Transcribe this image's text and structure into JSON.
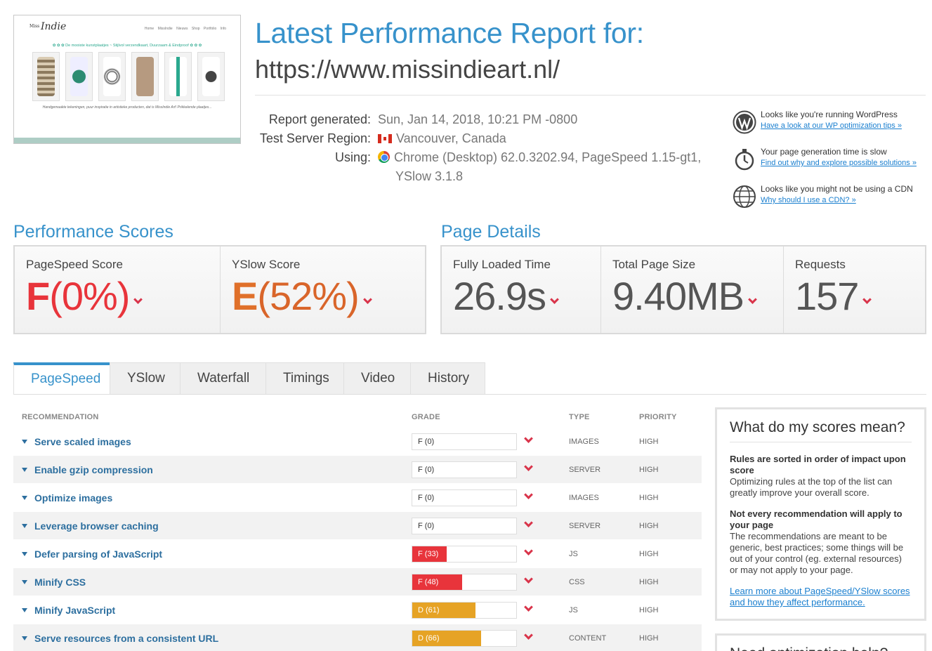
{
  "header": {
    "title": "Latest Performance Report for:",
    "url": "https://www.missindieart.nl/"
  },
  "thumbnail": {
    "logo": "Indie",
    "logo_small": "Miss",
    "nav": "Home MissIndie Nieuws Shop Portfolio Info",
    "strip": "✿ ✿ ✿  De mooiste kunstplaatjes ~ Stijlvol verzendkaart, Duurzaam & Eindproof  ✿ ✿ ✿",
    "paragraph": "Handgemaakte tekeningen, puur inspiratie in artistieke producten, dat is MissIndie Art! Prikkelende plaatjes..."
  },
  "meta": {
    "rows": [
      {
        "label": "Report generated:",
        "value": "Sun, Jan 14, 2018, 10:21 PM -0800"
      },
      {
        "label": "Test Server Region:",
        "value": "Vancouver, Canada"
      },
      {
        "label": "Using:",
        "value": "Chrome (Desktop) 62.0.3202.94, PageSpeed 1.15-gt1,",
        "value2": "YSlow 3.1.8"
      }
    ]
  },
  "tips": [
    {
      "icon": "wordpress-icon",
      "text": "Looks like you're running WordPress",
      "link": "Have a look at our WP optimization tips »"
    },
    {
      "icon": "stopwatch-icon",
      "text": "Your page generation time is slow",
      "link": "Find out why and explore possible solutions »"
    },
    {
      "icon": "globe-icon",
      "text": "Looks like you might not be using a CDN",
      "link": "Why should I use a CDN? »"
    }
  ],
  "performance": {
    "title": "Performance Scores",
    "pagespeed": {
      "label": "PageSpeed Score",
      "grade": "F",
      "pct": "(0%)"
    },
    "yslow": {
      "label": "YSlow Score",
      "grade": "E",
      "pct": "(52%)"
    }
  },
  "details": {
    "title": "Page Details",
    "loaded": {
      "label": "Fully Loaded Time",
      "value": "26.9s"
    },
    "size": {
      "label": "Total Page Size",
      "value": "9.40MB"
    },
    "requests": {
      "label": "Requests",
      "value": "157"
    }
  },
  "tabs": [
    "PageSpeed",
    "YSlow",
    "Waterfall",
    "Timings",
    "Video",
    "History"
  ],
  "table": {
    "headers": {
      "recommendation": "RECOMMENDATION",
      "grade": "GRADE",
      "type": "TYPE",
      "priority": "PRIORITY"
    },
    "rows": [
      {
        "name": "Serve scaled images",
        "grade": "F (0)",
        "score": 0,
        "type": "IMAGES",
        "priority": "HIGH"
      },
      {
        "name": "Enable gzip compression",
        "grade": "F (0)",
        "score": 0,
        "type": "SERVER",
        "priority": "HIGH"
      },
      {
        "name": "Optimize images",
        "grade": "F (0)",
        "score": 0,
        "type": "IMAGES",
        "priority": "HIGH"
      },
      {
        "name": "Leverage browser caching",
        "grade": "F (0)",
        "score": 0,
        "type": "SERVER",
        "priority": "HIGH"
      },
      {
        "name": "Defer parsing of JavaScript",
        "grade": "F (33)",
        "score": 33,
        "type": "JS",
        "priority": "HIGH"
      },
      {
        "name": "Minify CSS",
        "grade": "F (48)",
        "score": 48,
        "type": "CSS",
        "priority": "HIGH"
      },
      {
        "name": "Minify JavaScript",
        "grade": "D (61)",
        "score": 61,
        "type": "JS",
        "priority": "HIGH"
      },
      {
        "name": "Serve resources from a consistent URL",
        "grade": "D (66)",
        "score": 66,
        "type": "CONTENT",
        "priority": "HIGH"
      }
    ]
  },
  "colors": {
    "accent": "#3792cb",
    "grade_f": "#e8343b",
    "grade_d": "#e6a325",
    "grade_e": "#e0702a",
    "chevron": "#d9344a"
  },
  "sidebox": {
    "title": "What do my scores mean?",
    "p1_bold": "Rules are sorted in order of impact upon score",
    "p1": "Optimizing rules at the top of the list can greatly improve your overall score.",
    "p2_bold": "Not every recommendation will apply to your page",
    "p2": "The recommendations are meant to be generic, best practices; some things will be out of your control (eg. external resources) or may not apply to your page.",
    "link": "Learn more about PageSpeed/YSlow scores and how they affect performance.",
    "next_title": "Need optimization help?"
  }
}
